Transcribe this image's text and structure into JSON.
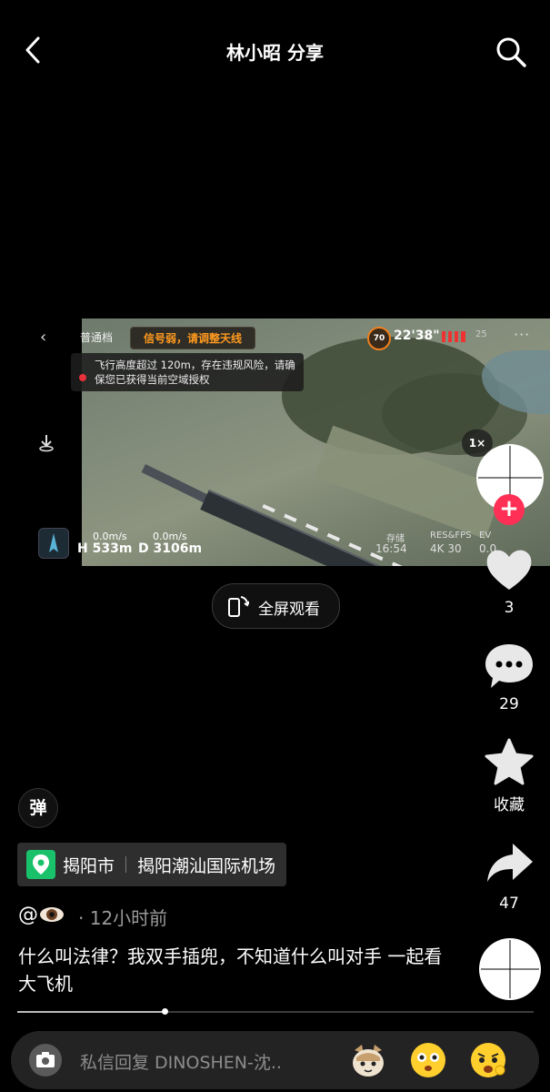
{
  "header": {
    "title": "林小昭 分享"
  },
  "video_overlay": {
    "mode": "普通档",
    "signal_warning": "信号弱，请调整天线",
    "altitude_warning": "飞行高度超过 120m，存在违规风险，请确保您已获得当前空域授权",
    "battery": "70",
    "flight_time": "22'38\"",
    "satellites": "25",
    "zoom": "1×",
    "h_speed": "0.0m/s",
    "v_speed": "0.0m/s",
    "height": "H 533m",
    "distance": "D 3106m",
    "storage_label": "存储",
    "storage_value": "16:54",
    "res_label": "RES&FPS",
    "res_value": "4K 30",
    "ev_label": "EV",
    "ev_value": "0.0"
  },
  "fullscreen_label": "全屏观看",
  "rail": {
    "likes": "3",
    "comments": "29",
    "favorite_label": "收藏",
    "shares": "47"
  },
  "danmaku_label": "弹",
  "location": {
    "city": "揭阳市",
    "place": "揭阳潮汕国际机场"
  },
  "author": {
    "at": "@",
    "time_ago": "· 12小时前"
  },
  "caption": "什么叫法律？我双手插兜，不知道什么叫对手 一起看大飞机",
  "progress": 0.285,
  "comment": {
    "placeholder": "私信回复 DINOSHEN-沈.."
  },
  "colors": {
    "accent": "#ff2f55",
    "location_pin": "#19c16a",
    "warning": "#ff9a1f"
  }
}
